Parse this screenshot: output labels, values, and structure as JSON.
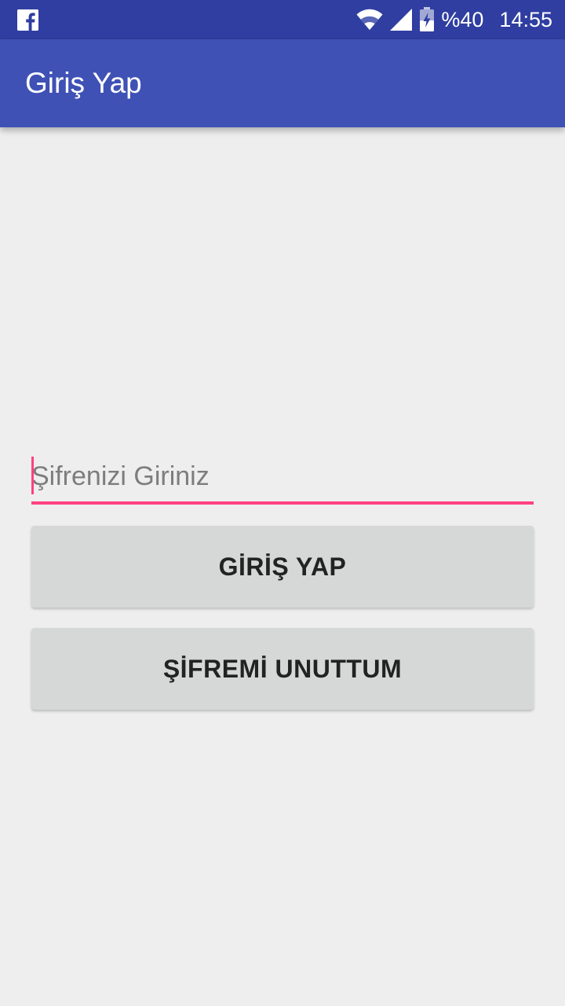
{
  "status_bar": {
    "notification_icon": "facebook-icon",
    "wifi_icon": "wifi-icon",
    "signal_icon": "cell-signal-icon",
    "battery_icon": "battery-charging-icon",
    "battery_text": "%40",
    "clock": "14:55",
    "background_color": "#2f3ea0"
  },
  "app_bar": {
    "title": "Giriş Yap",
    "background_color": "#3f51b5"
  },
  "password_field": {
    "value": "",
    "placeholder": "Şifrenizi Giriniz",
    "accent_color": "#ff4081"
  },
  "buttons": {
    "login_label": "GİRİŞ YAP",
    "forgot_label": "ŞİFREMİ UNUTTUM"
  }
}
